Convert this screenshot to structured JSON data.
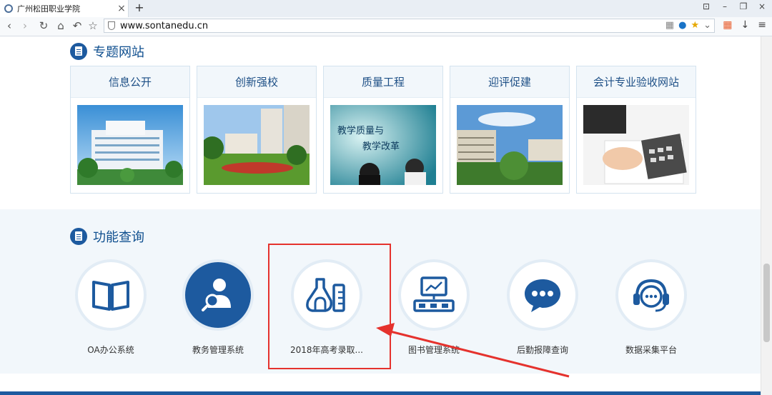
{
  "browser": {
    "tab_title": "广州松田职业学院",
    "tab_close": "×",
    "new_tab": "+",
    "url": "www.sontanedu.cn",
    "window_controls": [
      "⊡",
      "–",
      "❐",
      "×"
    ]
  },
  "section1": {
    "title": "专题网站",
    "cards": [
      {
        "label": "信息公开"
      },
      {
        "label": "创新强校"
      },
      {
        "label": "质量工程"
      },
      {
        "label": "迎评促建"
      },
      {
        "label": "会计专业验收网站"
      }
    ],
    "card3_overlay_text": [
      "教学质量与",
      "教学改革"
    ]
  },
  "section2": {
    "title": "功能查询",
    "items": [
      {
        "label": "OA办公系统"
      },
      {
        "label": "教务管理系统"
      },
      {
        "label": "2018年高考录取..."
      },
      {
        "label": "图书管理系统"
      },
      {
        "label": "后勤报障查询"
      },
      {
        "label": "数据采集平台"
      }
    ]
  },
  "colors": {
    "brand_blue": "#1d5a9f",
    "highlight_red": "#e5322d"
  }
}
